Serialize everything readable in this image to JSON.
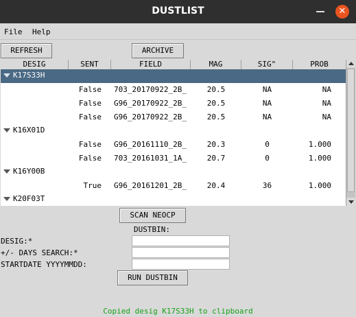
{
  "window": {
    "title": "DUSTLIST"
  },
  "menu": {
    "file": "File",
    "help": "Help"
  },
  "toolbar": {
    "refresh": "REFRESH",
    "archive": "ARCHIVE"
  },
  "tree": {
    "columns": [
      "DESIG",
      "SENT",
      "FIELD",
      "MAG",
      "SIG\"",
      "PROB"
    ],
    "groups": [
      {
        "desig": "K17S33H",
        "selected": true,
        "rows": [
          {
            "sent": "False",
            "field": "703_20170922_2B_",
            "mag": "20.5",
            "sig": "NA",
            "prob": "NA"
          },
          {
            "sent": "False",
            "field": "G96_20170922_2B_",
            "mag": "20.5",
            "sig": "NA",
            "prob": "NA"
          },
          {
            "sent": "False",
            "field": "G96_20170922_2B_",
            "mag": "20.5",
            "sig": "NA",
            "prob": "NA"
          }
        ]
      },
      {
        "desig": "K16X01D",
        "selected": false,
        "rows": [
          {
            "sent": "False",
            "field": "G96_20161110_2B_",
            "mag": "20.3",
            "sig": "0",
            "prob": "1.000"
          },
          {
            "sent": "False",
            "field": "703_20161031_1A_",
            "mag": "20.7",
            "sig": "0",
            "prob": "1.000"
          }
        ]
      },
      {
        "desig": "K16Y00B",
        "selected": false,
        "rows": [
          {
            "sent": "True",
            "field": "G96_20161201_2B_",
            "mag": "20.4",
            "sig": "36",
            "prob": "1.000"
          }
        ]
      },
      {
        "desig": "K20F03T",
        "selected": false,
        "rows": []
      }
    ]
  },
  "scan_button": "SCAN NEOCP",
  "dustbin": {
    "heading": "DUSTBIN:",
    "desig_label": "DESIG:*",
    "desig_value": "",
    "days_label": "+/- DAYS SEARCH:*",
    "days_value": "",
    "startdate_label": "STARTDATE YYYYMMDD:",
    "startdate_value": "",
    "run_button": "RUN DUSTBIN"
  },
  "status": {
    "message": "Copied desig K17S33H to clipboard",
    "color": "#18a018"
  },
  "colors": {
    "selection": "#4a6984",
    "titlebar": "#2f2f2f",
    "close": "#e95420"
  }
}
